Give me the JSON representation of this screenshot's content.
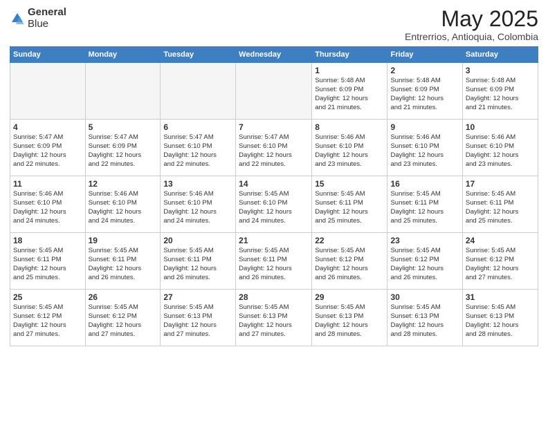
{
  "header": {
    "logo_line1": "General",
    "logo_line2": "Blue",
    "main_title": "May 2025",
    "subtitle": "Entrerrios, Antioquia, Colombia"
  },
  "weekdays": [
    "Sunday",
    "Monday",
    "Tuesday",
    "Wednesday",
    "Thursday",
    "Friday",
    "Saturday"
  ],
  "weeks": [
    [
      {
        "day": "",
        "info": ""
      },
      {
        "day": "",
        "info": ""
      },
      {
        "day": "",
        "info": ""
      },
      {
        "day": "",
        "info": ""
      },
      {
        "day": "1",
        "info": "Sunrise: 5:48 AM\nSunset: 6:09 PM\nDaylight: 12 hours\nand 21 minutes."
      },
      {
        "day": "2",
        "info": "Sunrise: 5:48 AM\nSunset: 6:09 PM\nDaylight: 12 hours\nand 21 minutes."
      },
      {
        "day": "3",
        "info": "Sunrise: 5:48 AM\nSunset: 6:09 PM\nDaylight: 12 hours\nand 21 minutes."
      }
    ],
    [
      {
        "day": "4",
        "info": "Sunrise: 5:47 AM\nSunset: 6:09 PM\nDaylight: 12 hours\nand 22 minutes."
      },
      {
        "day": "5",
        "info": "Sunrise: 5:47 AM\nSunset: 6:09 PM\nDaylight: 12 hours\nand 22 minutes."
      },
      {
        "day": "6",
        "info": "Sunrise: 5:47 AM\nSunset: 6:10 PM\nDaylight: 12 hours\nand 22 minutes."
      },
      {
        "day": "7",
        "info": "Sunrise: 5:47 AM\nSunset: 6:10 PM\nDaylight: 12 hours\nand 22 minutes."
      },
      {
        "day": "8",
        "info": "Sunrise: 5:46 AM\nSunset: 6:10 PM\nDaylight: 12 hours\nand 23 minutes."
      },
      {
        "day": "9",
        "info": "Sunrise: 5:46 AM\nSunset: 6:10 PM\nDaylight: 12 hours\nand 23 minutes."
      },
      {
        "day": "10",
        "info": "Sunrise: 5:46 AM\nSunset: 6:10 PM\nDaylight: 12 hours\nand 23 minutes."
      }
    ],
    [
      {
        "day": "11",
        "info": "Sunrise: 5:46 AM\nSunset: 6:10 PM\nDaylight: 12 hours\nand 24 minutes."
      },
      {
        "day": "12",
        "info": "Sunrise: 5:46 AM\nSunset: 6:10 PM\nDaylight: 12 hours\nand 24 minutes."
      },
      {
        "day": "13",
        "info": "Sunrise: 5:46 AM\nSunset: 6:10 PM\nDaylight: 12 hours\nand 24 minutes."
      },
      {
        "day": "14",
        "info": "Sunrise: 5:45 AM\nSunset: 6:10 PM\nDaylight: 12 hours\nand 24 minutes."
      },
      {
        "day": "15",
        "info": "Sunrise: 5:45 AM\nSunset: 6:11 PM\nDaylight: 12 hours\nand 25 minutes."
      },
      {
        "day": "16",
        "info": "Sunrise: 5:45 AM\nSunset: 6:11 PM\nDaylight: 12 hours\nand 25 minutes."
      },
      {
        "day": "17",
        "info": "Sunrise: 5:45 AM\nSunset: 6:11 PM\nDaylight: 12 hours\nand 25 minutes."
      }
    ],
    [
      {
        "day": "18",
        "info": "Sunrise: 5:45 AM\nSunset: 6:11 PM\nDaylight: 12 hours\nand 25 minutes."
      },
      {
        "day": "19",
        "info": "Sunrise: 5:45 AM\nSunset: 6:11 PM\nDaylight: 12 hours\nand 26 minutes."
      },
      {
        "day": "20",
        "info": "Sunrise: 5:45 AM\nSunset: 6:11 PM\nDaylight: 12 hours\nand 26 minutes."
      },
      {
        "day": "21",
        "info": "Sunrise: 5:45 AM\nSunset: 6:11 PM\nDaylight: 12 hours\nand 26 minutes."
      },
      {
        "day": "22",
        "info": "Sunrise: 5:45 AM\nSunset: 6:12 PM\nDaylight: 12 hours\nand 26 minutes."
      },
      {
        "day": "23",
        "info": "Sunrise: 5:45 AM\nSunset: 6:12 PM\nDaylight: 12 hours\nand 26 minutes."
      },
      {
        "day": "24",
        "info": "Sunrise: 5:45 AM\nSunset: 6:12 PM\nDaylight: 12 hours\nand 27 minutes."
      }
    ],
    [
      {
        "day": "25",
        "info": "Sunrise: 5:45 AM\nSunset: 6:12 PM\nDaylight: 12 hours\nand 27 minutes."
      },
      {
        "day": "26",
        "info": "Sunrise: 5:45 AM\nSunset: 6:12 PM\nDaylight: 12 hours\nand 27 minutes."
      },
      {
        "day": "27",
        "info": "Sunrise: 5:45 AM\nSunset: 6:13 PM\nDaylight: 12 hours\nand 27 minutes."
      },
      {
        "day": "28",
        "info": "Sunrise: 5:45 AM\nSunset: 6:13 PM\nDaylight: 12 hours\nand 27 minutes."
      },
      {
        "day": "29",
        "info": "Sunrise: 5:45 AM\nSunset: 6:13 PM\nDaylight: 12 hours\nand 28 minutes."
      },
      {
        "day": "30",
        "info": "Sunrise: 5:45 AM\nSunset: 6:13 PM\nDaylight: 12 hours\nand 28 minutes."
      },
      {
        "day": "31",
        "info": "Sunrise: 5:45 AM\nSunset: 6:13 PM\nDaylight: 12 hours\nand 28 minutes."
      }
    ]
  ]
}
